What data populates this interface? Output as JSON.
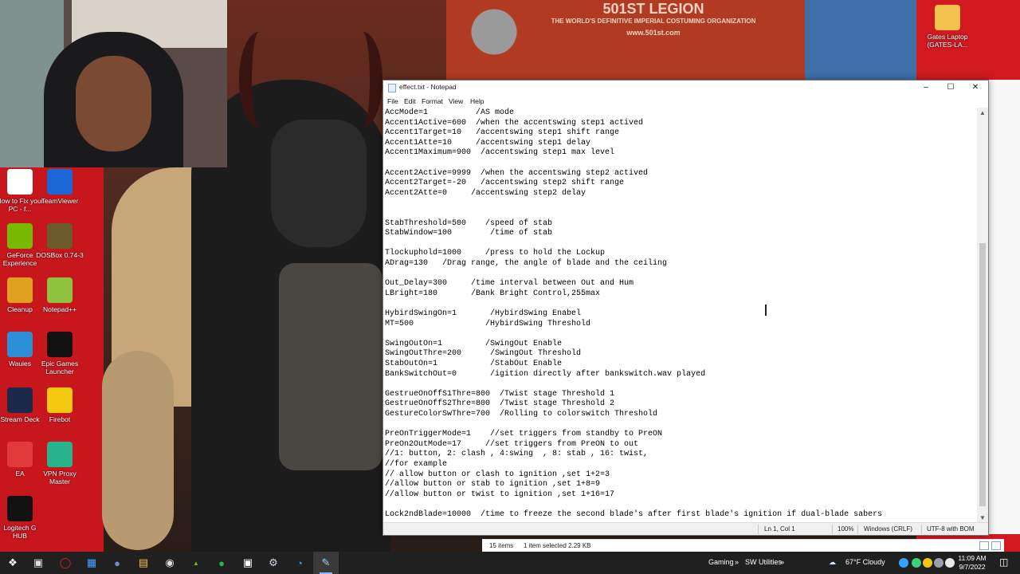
{
  "background": {
    "banner_top": "501ST LEGION",
    "banner_tagline": "THE WORLD'S DEFINITIVE IMPERIAL COSTUMING ORGANIZATION",
    "banner_url": "www.501st.com"
  },
  "desktop_icons": [
    {
      "label": "How to Fix your PC - f...",
      "icon": "document-icon",
      "color": "#ffffff"
    },
    {
      "label": "TeamViewer",
      "icon": "teamviewer-icon",
      "color": "#1a68d6"
    },
    {
      "label": "GeForce Experience",
      "icon": "geforce-icon",
      "color": "#76b900"
    },
    {
      "label": "DOSBox 0.74-3",
      "icon": "dosbox-icon",
      "color": "#6b5a2a"
    },
    {
      "label": "Cleanup",
      "icon": "broom-icon",
      "color": "#e0a020"
    },
    {
      "label": "Notepad++",
      "icon": "notepadpp-icon",
      "color": "#8fc23f"
    },
    {
      "label": "Wauies",
      "icon": "paw-icon",
      "color": "#2a8fd6"
    },
    {
      "label": "Epic Games Launcher",
      "icon": "epic-icon",
      "color": "#111111"
    },
    {
      "label": "Stream Deck",
      "icon": "streamdeck-icon",
      "color": "#1b2a4a"
    },
    {
      "label": "Firebot",
      "icon": "firebot-icon",
      "color": "#f2c811"
    },
    {
      "label": "EA",
      "icon": "ea-icon",
      "color": "#e23a3a"
    },
    {
      "label": "VPN Proxy Master",
      "icon": "vpn-key-icon",
      "color": "#27b48a"
    },
    {
      "label": "Logitech G HUB",
      "icon": "logitech-icon",
      "color": "#111111"
    },
    {
      "label": "Gates Laptop (GATES-LA...",
      "icon": "folder-icon",
      "color": "#f2c14e"
    }
  ],
  "notepad": {
    "title": "effect.txt - Notepad",
    "menu": [
      "File",
      "Edit",
      "Format",
      "View",
      "Help"
    ],
    "lines": [
      "AccMode=1          /AS mode",
      "Accent1Active=600  /when the accentswing step1 actived",
      "Accent1Target=10   /accentswing step1 shift range",
      "Accent1Atte=10     /accentswing step1 delay",
      "Accent1Maximum=900  /accentswing step1 max level",
      "",
      "Accent2Active=9999  /when the accentswing step2 actived",
      "Accent2Target=-20   /accentswing step2 shift range",
      "Accent2Atte=0     /accentswing step2 delay",
      "",
      "",
      "StabThreshold=500    /speed of stab",
      "StabWindow=100        /time of stab",
      "",
      "Tlockuphold=1000     /press to hold the Lockup",
      "ADrag=130   /Drag range, the angle of blade and the ceiling",
      "",
      "Out_Delay=300     /time interval between Out and Hum",
      "LBright=180       /Bank Bright Control,255max",
      "",
      "HybirdSwingOn=1       /HybirdSwing Enabel",
      "MT=500               /HybirdSwing Threshold",
      "",
      "SwingOutOn=1         /SwingOut Enable",
      "SwingOutThre=200      /SwingOut Threshold",
      "StabOutOn=1           /StabOut Enable",
      "BankSwitchOut=0       /igition directly after bankswitch.wav played",
      "",
      "GestrueOnOffS1Thre=800  /Twist stage Threshold 1",
      "GestrueOnOffS2Thre=800  /Twist stage Threshold 2",
      "GestureColorSwThre=700  /Rolling to colorswitch Threshold",
      "",
      "PreOnTriggerMode=1    //set triggers from standby to PreON",
      "PreOn2OutMode=17     //set triggers from PreON to out",
      "//1: button, 2: clash , 4:swing  , 8: stab , 16: twist,",
      "//for example",
      "// allow button or clash to ignition ,set 1+2=3",
      "//allow button or stab to ignition ,set 1+8=9",
      "//allow button or twist to ignition ,set 1+16=17",
      "",
      "Lock2ndBlade=10000  /time to freeze the second blade's after first blade's ignition if dual-blade sabers"
    ],
    "status": {
      "position": "Ln 1, Col 1",
      "zoom": "100%",
      "line_ending": "Windows (CRLF)",
      "encoding": "UTF-8 with BOM"
    }
  },
  "explorer_status": {
    "items": "15 items",
    "selected": "1 item selected  2.29 KB"
  },
  "taskbar": {
    "gaming": "Gaming",
    "sw_utilities": "SW Utilities",
    "weather": "67°F  Cloudy",
    "time": "11:09 AM",
    "date": "9/7/2022"
  },
  "colors": {
    "taskbar": "#202020",
    "wall_red": "#c8161d",
    "accent_blue": "#0078d4"
  }
}
